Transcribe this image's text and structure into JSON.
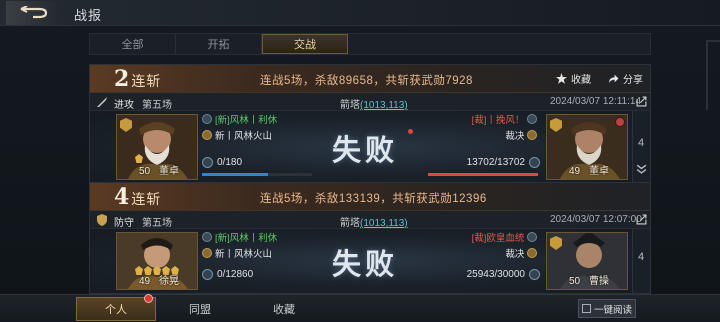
{
  "header": {
    "title": "战报"
  },
  "tabs": [
    {
      "label": "全部",
      "active": false
    },
    {
      "label": "开拓",
      "active": false
    },
    {
      "label": "交战",
      "active": true
    }
  ],
  "reports": [
    {
      "streak_num": "2",
      "streak_label": "连斩",
      "summary": "连战5场，杀敌89658，共斩获武勋7928",
      "fav_label": "收藏",
      "share_label": "分享",
      "mode": "进攻",
      "round": "第五场",
      "location": "箭塔",
      "coords": "(1013,113)",
      "time": "2024/03/07 12:11:14",
      "left": {
        "guild": "[新]风林丨利休",
        "role": "新丨风林火山",
        "troops": "0/180",
        "troop_fraction": 0.6,
        "level": "50",
        "name": "董卓"
      },
      "right": {
        "guild": "[裁]丨挽风！",
        "role": "裁决",
        "troops": "13702/13702",
        "troop_fraction": 1.0,
        "level": "49",
        "name": "董卓"
      },
      "result": "失败",
      "side_num": "4"
    },
    {
      "streak_num": "4",
      "streak_label": "连斩",
      "summary": "连战5场，杀敌133139，共斩获武勋12396",
      "fav_label": "收藏",
      "share_label": "分享",
      "mode": "防守",
      "round": "第五场",
      "location": "箭塔",
      "coords": "(1013,113)",
      "time": "2024/03/07 12:07:00",
      "left": {
        "guild": "[新]风林丨利休",
        "role": "新丨风林火山",
        "troops": "0/12860",
        "troop_fraction": 0.0,
        "level": "49",
        "name": "徐晃"
      },
      "right": {
        "guild": "[裁]欧皇血统",
        "role": "裁决",
        "troops": "25943/30000",
        "troop_fraction": 0.86,
        "level": "50",
        "name": "曹操"
      },
      "result": "失败",
      "side_num": "4"
    }
  ],
  "bottom_tabs": [
    {
      "label": "个人",
      "active": true
    },
    {
      "label": "同盟",
      "active": false
    },
    {
      "label": "收藏",
      "active": false
    }
  ],
  "one_key_read": "一键阅读",
  "colors": {
    "accent_gold": "#e9b98b",
    "friendly_guild": "#5fc96a",
    "enemy_guild": "#e25a4e",
    "coords": "#5fc0d8"
  }
}
